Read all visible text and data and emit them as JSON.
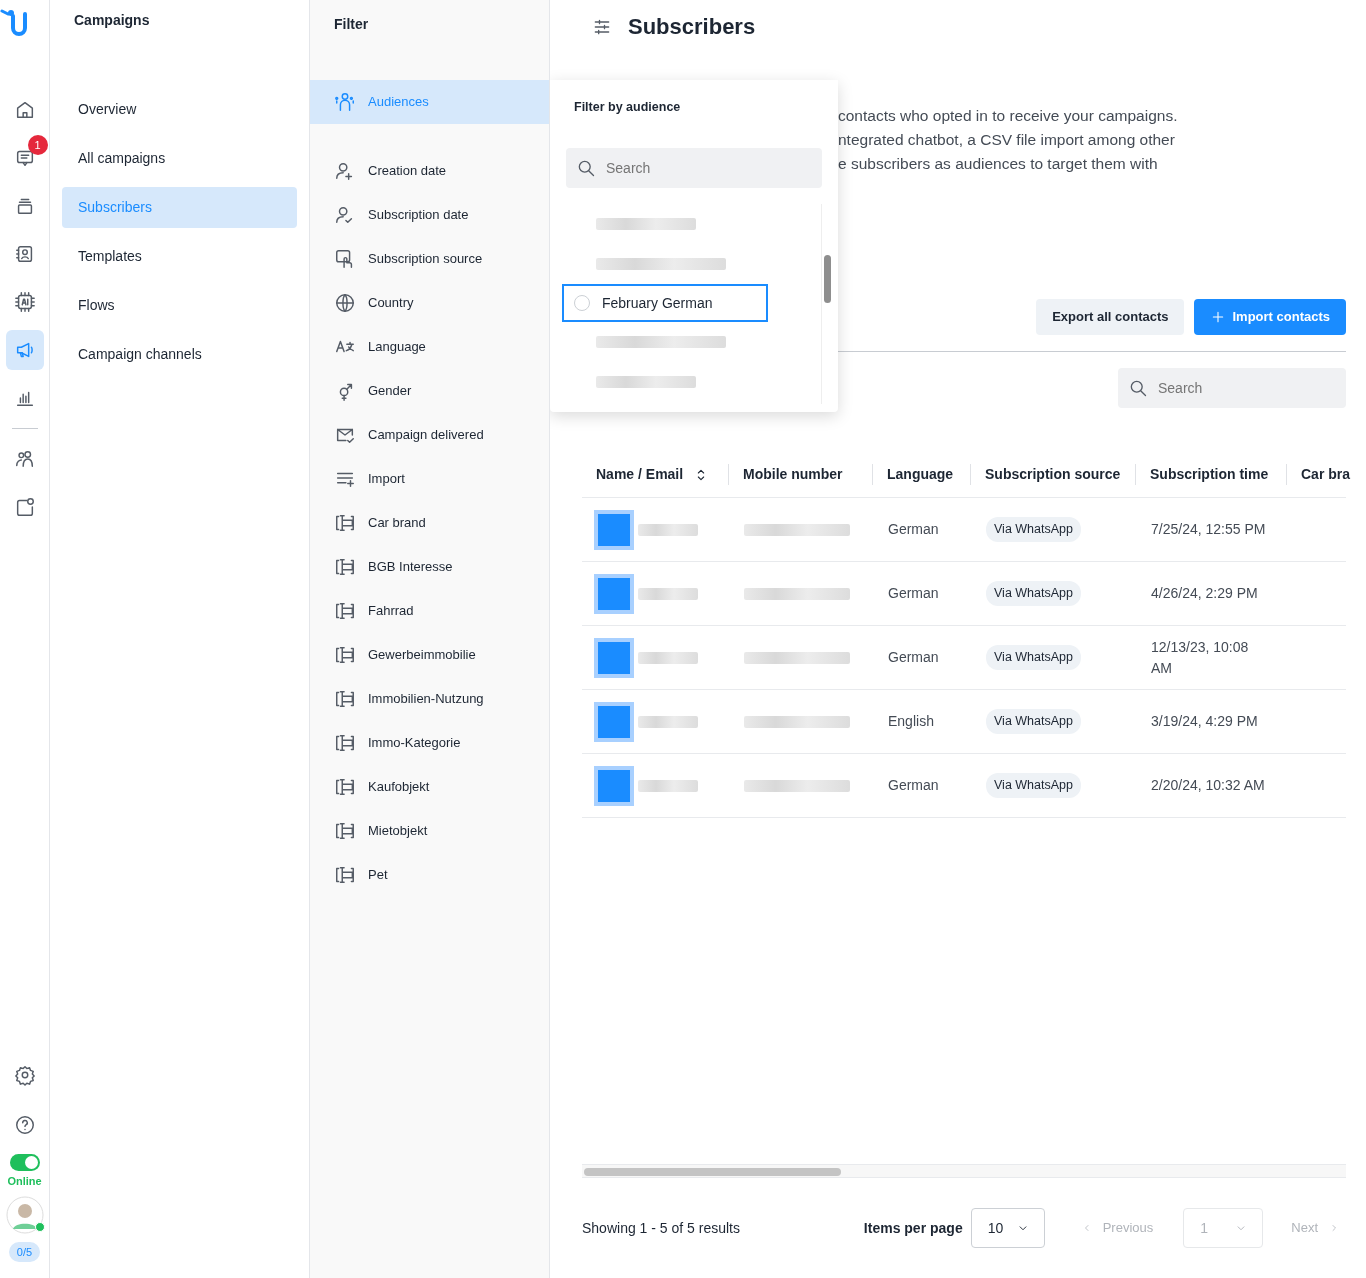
{
  "rail": {
    "items": [
      {
        "selected": false
      },
      {
        "selected": false,
        "badge": "1"
      },
      {
        "selected": false
      },
      {
        "selected": false
      },
      {
        "selected": false
      },
      {
        "selected": true
      },
      {
        "selected": false
      },
      {
        "selected": false
      },
      {
        "selected": false
      }
    ],
    "status_toggle": {
      "on": true,
      "label": "Online"
    },
    "counter": "0/5"
  },
  "nav": {
    "title": "Campaigns",
    "items": [
      {
        "label": "Overview",
        "selected": false
      },
      {
        "label": "All campaigns",
        "selected": false
      },
      {
        "label": "Subscribers",
        "selected": true
      },
      {
        "label": "Templates",
        "selected": false
      },
      {
        "label": "Flows",
        "selected": false
      },
      {
        "label": "Campaign channels",
        "selected": false
      }
    ]
  },
  "filter": {
    "title": "Filter",
    "items": [
      {
        "label": "Audiences",
        "kind": "audience",
        "selected": true
      },
      {
        "label": "Creation date",
        "kind": "builtin",
        "selected": false
      },
      {
        "label": "Subscription date",
        "kind": "builtin",
        "selected": false
      },
      {
        "label": "Subscription source",
        "kind": "builtin",
        "selected": false
      },
      {
        "label": "Country",
        "kind": "builtin",
        "selected": false
      },
      {
        "label": "Language",
        "kind": "builtin",
        "selected": false
      },
      {
        "label": "Gender",
        "kind": "builtin",
        "selected": false
      },
      {
        "label": "Campaign delivered",
        "kind": "builtin",
        "selected": false
      },
      {
        "label": "Import",
        "kind": "builtin",
        "selected": false
      },
      {
        "label": "Car brand",
        "kind": "field",
        "selected": false
      },
      {
        "label": "BGB Interesse",
        "kind": "field",
        "selected": false
      },
      {
        "label": "Fahrrad",
        "kind": "field",
        "selected": false
      },
      {
        "label": "Gewerbeimmobilie",
        "kind": "field",
        "selected": false
      },
      {
        "label": "Immobilien-Nutzung",
        "kind": "field",
        "selected": false
      },
      {
        "label": "Immo-Kategorie",
        "kind": "field",
        "selected": false
      },
      {
        "label": "Kaufobjekt",
        "kind": "field",
        "selected": false
      },
      {
        "label": "Mietobjekt",
        "kind": "field",
        "selected": false
      },
      {
        "label": "Pet",
        "kind": "field",
        "selected": false
      }
    ]
  },
  "audience_popup": {
    "title": "Filter by audience",
    "search": {
      "placeholder": "Search"
    },
    "options": [
      {
        "kind": "redacted"
      },
      {
        "kind": "redacted"
      },
      {
        "kind": "option",
        "label": "February German",
        "selected": false,
        "focused": true
      },
      {
        "kind": "redacted"
      },
      {
        "kind": "redacted"
      }
    ]
  },
  "page": {
    "title": "Subscribers",
    "description_lines": [
      "contacts who opted in to receive your campaigns.",
      "ntegrated chatbot, a CSV file import among other",
      "e subscribers as audiences to target them with"
    ],
    "buttons": {
      "export": "Export all contacts",
      "import": "Import contacts"
    },
    "search": {
      "placeholder": "Search"
    }
  },
  "table": {
    "columns": [
      "Name / Email",
      "Mobile number",
      "Language",
      "Subscription source",
      "Subscription time",
      "Car bra"
    ],
    "rows": [
      {
        "language": "German",
        "source": "Via WhatsApp",
        "time": "7/25/24, 12:55 PM"
      },
      {
        "language": "German",
        "source": "Via WhatsApp",
        "time": "4/26/24, 2:29 PM"
      },
      {
        "language": "German",
        "source": "Via WhatsApp",
        "time": "12/13/23, 10:08 AM"
      },
      {
        "language": "English",
        "source": "Via WhatsApp",
        "time": "3/19/24, 4:29 PM"
      },
      {
        "language": "German",
        "source": "Via WhatsApp",
        "time": "2/20/24, 10:32 AM"
      }
    ]
  },
  "footer": {
    "showing": "Showing 1 - 5 of 5 results",
    "items_per_page_label": "Items per page",
    "items_per_page": "10",
    "previous": "Previous",
    "page": "1",
    "next": "Next",
    "previous_disabled": true,
    "next_disabled": true
  }
}
